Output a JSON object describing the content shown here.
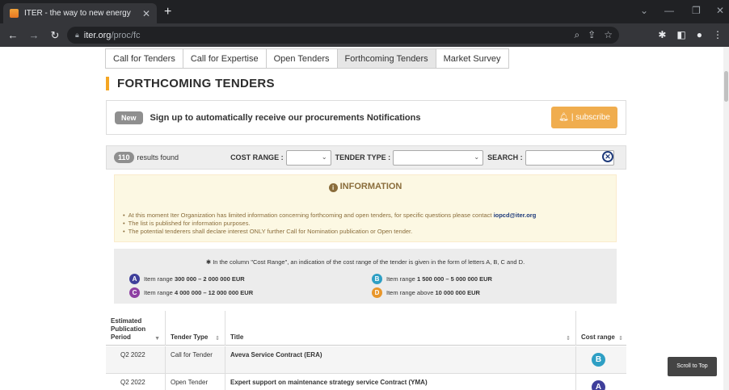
{
  "browser": {
    "tab_title": "ITER - the way to new energy",
    "url_host": "iter.org",
    "url_path": "/proc/fc"
  },
  "page": {
    "subtabs": [
      {
        "label": "Call for Tenders",
        "active": false
      },
      {
        "label": "Call for Expertise",
        "active": false
      },
      {
        "label": "Open Tenders",
        "active": false
      },
      {
        "label": "Forthcoming Tenders",
        "active": true
      },
      {
        "label": "Market Survey",
        "active": false
      }
    ],
    "heading": "FORTHCOMING TENDERS",
    "notify": {
      "badge": "New",
      "text": "Sign up to automatically receive our procurements Notifications",
      "subscribe_label": "| subscribe"
    },
    "filters": {
      "count": "110",
      "count_text": "results found",
      "cost_range_label": "COST RANGE :",
      "tender_type_label": "TENDER TYPE :",
      "search_label": "SEARCH :"
    },
    "info": {
      "title": "INFORMATION",
      "line1_text": "At this moment Iter Organization has limited information concerning forthcoming and open tenders, for specific questions please contact",
      "line1_email": "iopcd@iter.org",
      "line2": "The list is published for information purposes.",
      "line3": "The potential tenderers shall declare interest ONLY further Call for Nomination publication or Open tender."
    },
    "legend": {
      "note": "In the column \"Cost Range\", an indication of the cost range of the tender is given in the form of letters A, B, C and D.",
      "items": [
        {
          "letter": "A",
          "prefix": "Item range",
          "range": "300 000 – 2 000 000 EUR"
        },
        {
          "letter": "B",
          "prefix": "Item range",
          "range": "1 500 000 – 5 000 000 EUR"
        },
        {
          "letter": "C",
          "prefix": "Item range",
          "range": "4 000 000 – 12 000 000 EUR"
        },
        {
          "letter": "D",
          "prefix": "Item range above",
          "range": "10 000 000 EUR"
        }
      ]
    },
    "table": {
      "headers": {
        "period_line1": "Estimated",
        "period_line2": "Publication",
        "period_line3": "Period",
        "type": "Tender Type",
        "title": "Title",
        "cost": "Cost range"
      },
      "rows": [
        {
          "period": "Q2 2022",
          "type": "Call for Tender",
          "title": "Aveva Service Contract (ERA)",
          "cost": "B"
        },
        {
          "period": "Q2 2022",
          "type": "Open Tender",
          "title": "Expert support on maintenance strategy service Contract (YMA)",
          "cost": "A"
        }
      ]
    },
    "scroll_top_label": "Scroll to Top"
  },
  "colors": {
    "accent": "#f5a623",
    "subscribe": "#f0ad4e",
    "range_a": "#3f3f9b",
    "range_b": "#2e9fc4",
    "range_c": "#8e3fa3",
    "range_d": "#e8962a"
  }
}
